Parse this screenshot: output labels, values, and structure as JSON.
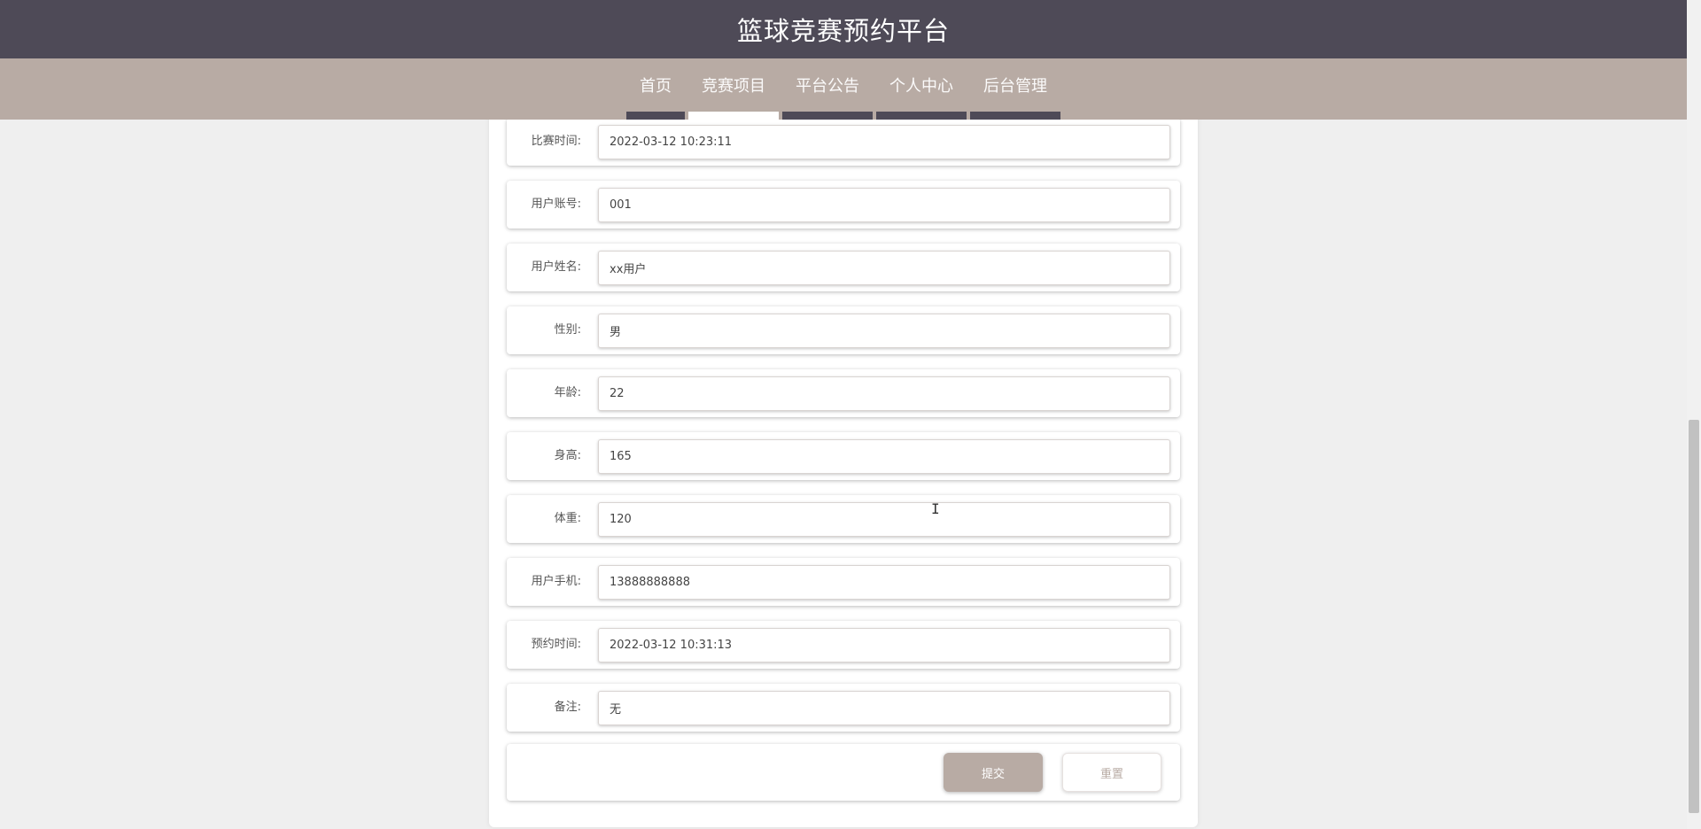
{
  "header": {
    "title": "篮球竞赛预约平台"
  },
  "nav": {
    "items": [
      {
        "label": "首页"
      },
      {
        "label": "竞赛项目"
      },
      {
        "label": "平台公告"
      },
      {
        "label": "个人中心"
      },
      {
        "label": "后台管理"
      }
    ],
    "active_index": 1
  },
  "form": {
    "fields": [
      {
        "label": "比赛时间:",
        "value": "2022-03-12 10:23:11"
      },
      {
        "label": "用户账号:",
        "value": "001"
      },
      {
        "label": "用户姓名:",
        "value": "xx用户"
      },
      {
        "label": "性别:",
        "value": "男"
      },
      {
        "label": "年龄:",
        "value": "22"
      },
      {
        "label": "身高:",
        "value": "165"
      },
      {
        "label": "体重:",
        "value": "120"
      },
      {
        "label": "用户手机:",
        "value": "13888888888"
      },
      {
        "label": "预约时间:",
        "value": "2022-03-12 10:31:13"
      },
      {
        "label": "备注:",
        "value": "无"
      }
    ],
    "submit_label": "提交",
    "reset_label": "重置"
  },
  "colors": {
    "header_bg": "#4e4a57",
    "nav_bg": "#b8aba4",
    "accent": "#b8aba4"
  }
}
